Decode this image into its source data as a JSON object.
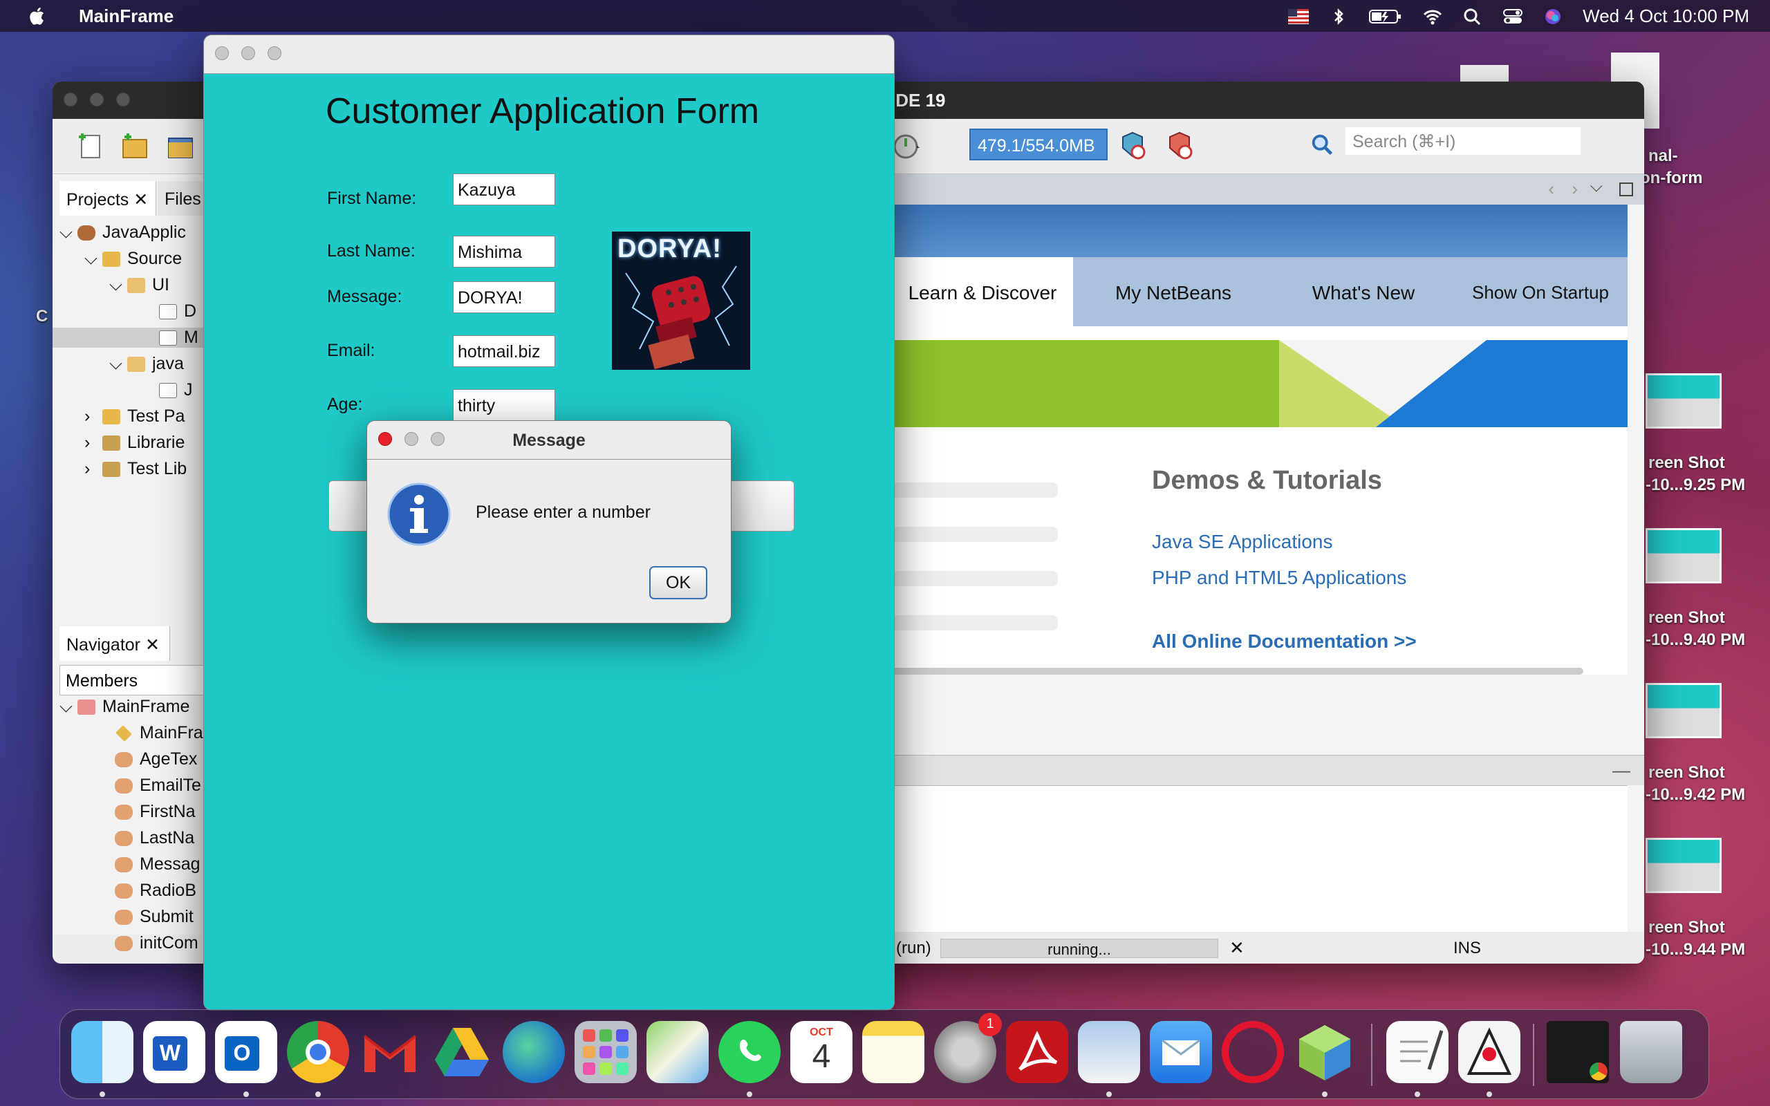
{
  "menubar": {
    "app_name": "MainFrame",
    "datetime": "Wed 4 Oct  10:00 PM",
    "icons": [
      "apple-icon",
      "flag-icon",
      "bluetooth-icon",
      "battery-icon",
      "wifi-icon",
      "search-icon",
      "control-center-icon",
      "siri-icon"
    ]
  },
  "netbeans": {
    "title": "IDE 19",
    "memory": "479.1/554.0MB",
    "search_placeholder": "Search (⌘+I)",
    "left_tabs": [
      "Projects",
      "Files"
    ],
    "tree": [
      "JavaApplic",
      "Source",
      "UI",
      "D",
      "M",
      "java",
      "J",
      "Test Pa",
      "Librarie",
      "Test Lib"
    ],
    "navigator_tab": "Navigator",
    "members": "Members",
    "nav_tree": [
      "MainFrame",
      "MainFra",
      "AgeTex",
      "EmailTe",
      "FirstNa",
      "LastNa",
      "Messag",
      "RadioB",
      "Submit",
      "initCom"
    ],
    "welcome_tabs": [
      "Learn & Discover",
      "My NetBeans",
      "What's New",
      "Show On Startup"
    ],
    "demos_title": "Demos & Tutorials",
    "links": [
      "Java SE Applications",
      "PHP and HTML5 Applications"
    ],
    "all_docs": "All Online Documentation >>",
    "status": {
      "run": "(run)",
      "progress": "running...",
      "mode": "INS"
    }
  },
  "form": {
    "title": "Customer Application Form",
    "fields": [
      {
        "label": "First Name:",
        "value": "Kazuya"
      },
      {
        "label": "Last Name:",
        "value": "Mishima"
      },
      {
        "label": "Message:",
        "value": "DORYA!"
      },
      {
        "label": "Email:",
        "value": "hotmail.biz"
      },
      {
        "label": "Age:",
        "value": "thirty"
      }
    ],
    "image_text": "DORYA!"
  },
  "dialog": {
    "title": "Message",
    "message": "Please enter a number",
    "ok_label": "OK"
  },
  "desktop": {
    "files": [
      "nal-",
      "on-form"
    ],
    "screenshots": [
      {
        "line1": "reen Shot",
        "line2": "-10...9.25 PM"
      },
      {
        "line1": "reen Shot",
        "line2": "-10...9.40 PM"
      },
      {
        "line1": "reen Shot",
        "line2": "-10...9.42 PM"
      },
      {
        "line1": "reen Shot",
        "line2": "-10...9.44 PM"
      }
    ],
    "left_label": "C"
  },
  "dock": {
    "apps": [
      "Finder",
      "Word",
      "Outlook",
      "Chrome",
      "Gmail",
      "Google Drive",
      "Edge",
      "Launchpad",
      "Maps",
      "WhatsApp",
      "Calendar",
      "Notes",
      "System Settings",
      "Acrobat",
      "Preview",
      "Mail",
      "Opera",
      "NetBeans",
      "TextEdit",
      "Java",
      "Screenshot",
      "Trash"
    ],
    "calendar_month": "OCT",
    "calendar_day": "4",
    "settings_badge": "1"
  }
}
